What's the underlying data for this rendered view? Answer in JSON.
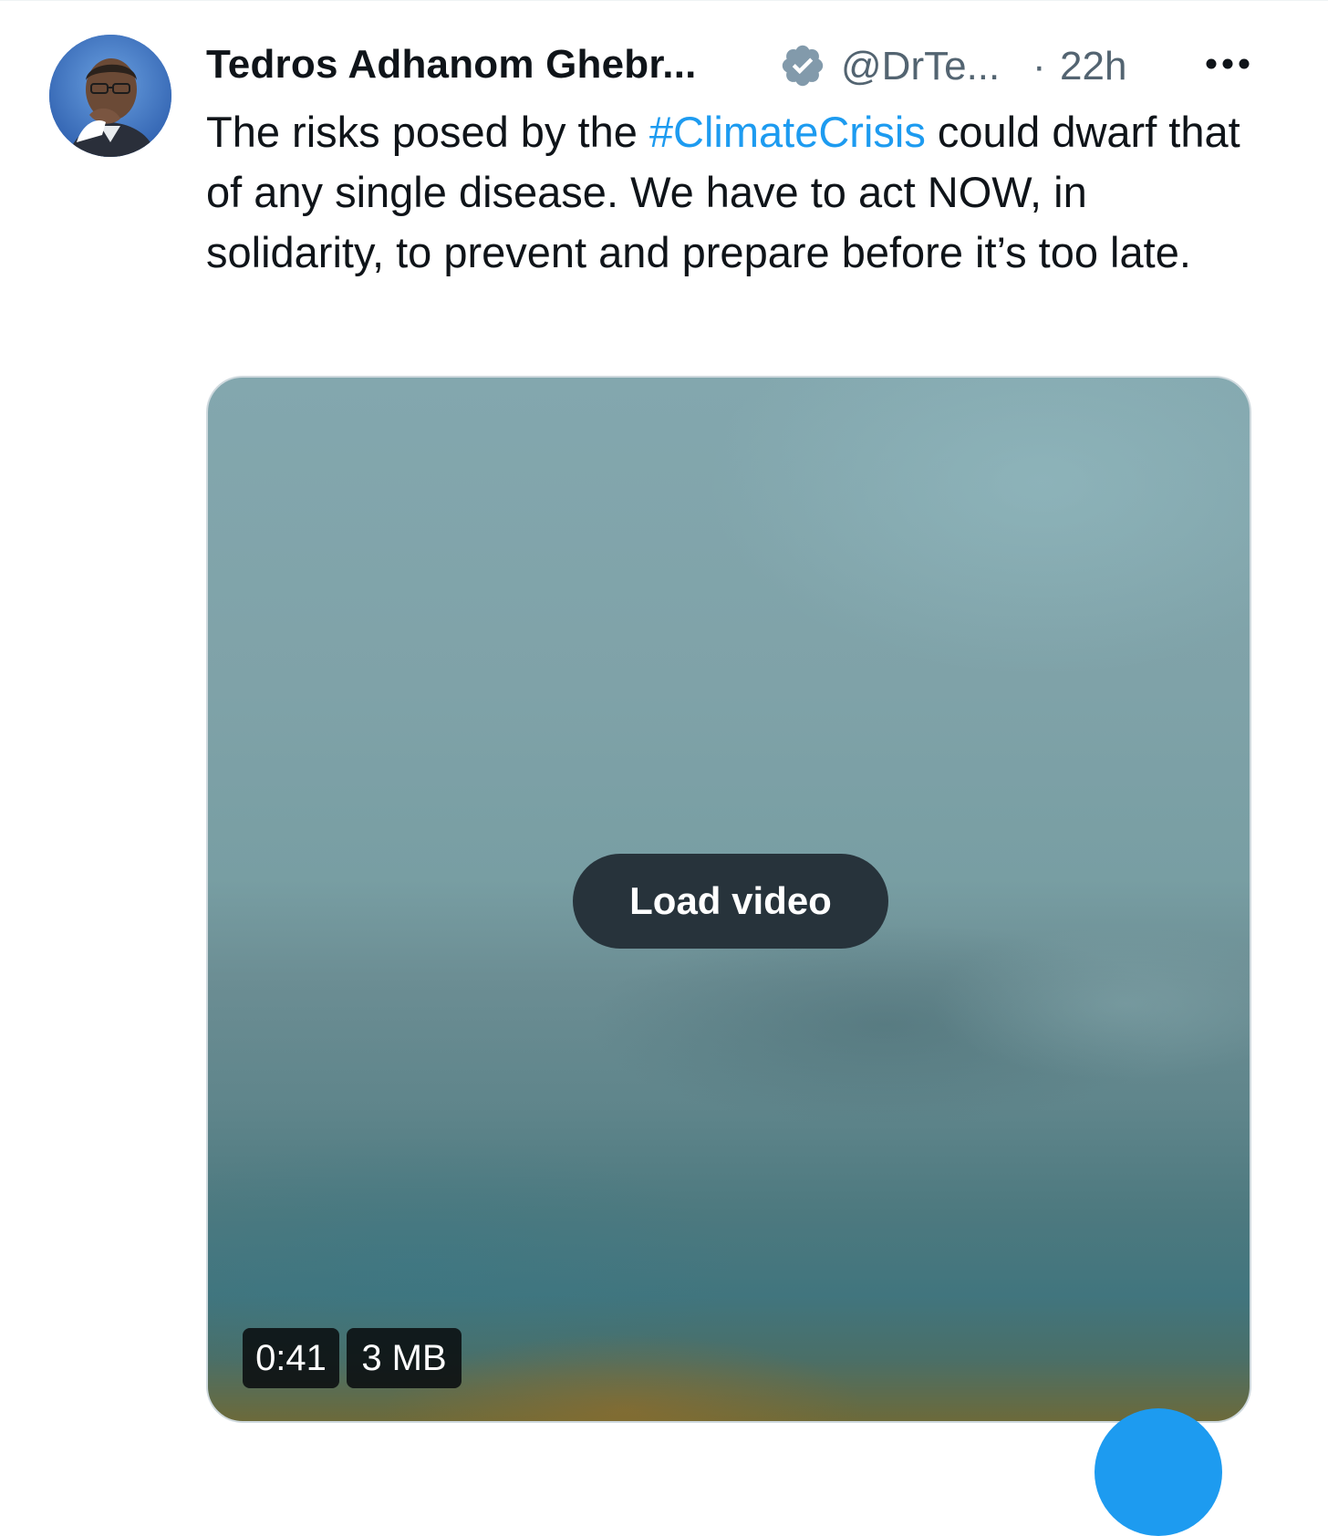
{
  "tweet": {
    "author": {
      "display_name": "Tedros Adhanom Ghebr...",
      "handle": "@DrTe...",
      "verified": true
    },
    "separator": "·",
    "timestamp": "22h",
    "text_before": "The risks posed by the ",
    "hashtag": "#ClimateCrisis",
    "text_after": " could dwarf that of any single disease. We have to act NOW, in solidarity, to prevent and prepare before it’s too late.",
    "media": {
      "load_label": "Load video",
      "duration": "0:41",
      "size": "3 MB"
    }
  },
  "icons": {
    "more": "more-horizontal-icon",
    "verified": "verified-badge-icon"
  },
  "colors": {
    "link": "#1d9bf0",
    "text": "#0f1419",
    "secondary": "#536471",
    "verified_badge": "#829aab"
  }
}
